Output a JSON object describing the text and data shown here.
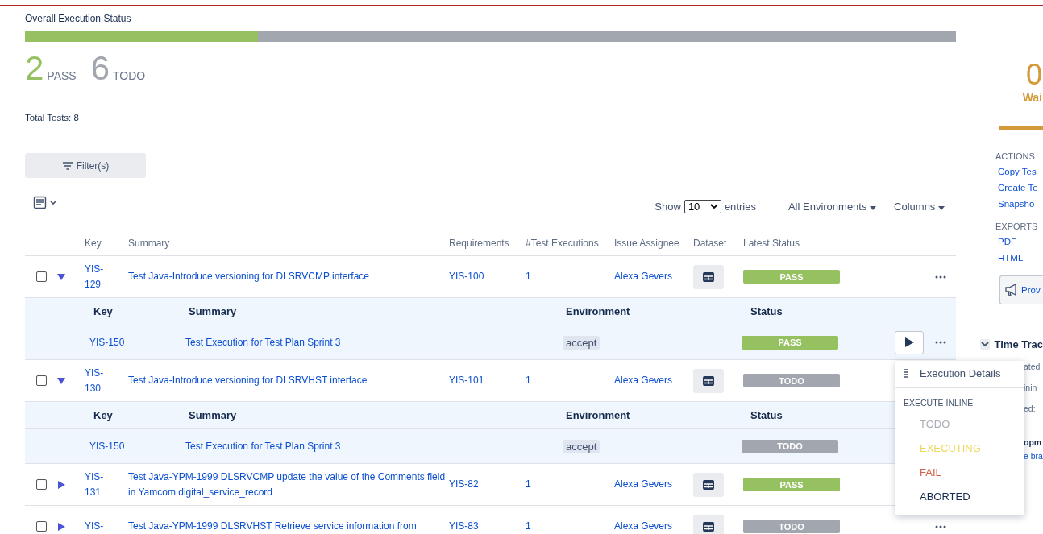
{
  "title": "Overall Execution Status",
  "progress": {
    "level": 0.25
  },
  "counts": [
    {
      "number": "2",
      "label": "PASS",
      "kind": "pass"
    },
    {
      "number": "6",
      "label": "TODO",
      "kind": "todo"
    }
  ],
  "total": "Total Tests: 8",
  "filter_button": "Filter(s)",
  "show": {
    "prefix": "Show",
    "value": "10",
    "suffix": "entries"
  },
  "environment_dropdown": "All Environments",
  "columns_dropdown": "Columns",
  "table": {
    "columns": [
      "Key",
      "Summary",
      "Requirements",
      "#Test Executions",
      "Issue Assignee",
      "Dataset",
      "Latest Status"
    ],
    "rows": [
      {
        "checked": false,
        "expanded": true,
        "key": "YIS-129",
        "summary": "Test Java-Introduce versioning for DLSRVCMP interface",
        "requirement": "YIS-100",
        "executions": "1",
        "assignee": "Alexa Gevers",
        "status": {
          "label": "PASS",
          "kind": "pass"
        },
        "sub": {
          "columns": [
            "Key",
            "Summary",
            "Environment",
            "Status"
          ],
          "rows": [
            {
              "key": "YIS-150",
              "summary": "Test Execution for Test Plan Sprint 3",
              "environment": "accept",
              "status": {
                "label": "PASS",
                "kind": "pass"
              },
              "run_button": true
            }
          ]
        }
      },
      {
        "checked": false,
        "expanded": true,
        "key": "YIS-130",
        "summary": "Test Java-Introduce versioning for DLSRVHST interface",
        "requirement": "YIS-101",
        "executions": "1",
        "assignee": "Alexa Gevers",
        "status": {
          "label": "TODO",
          "kind": "todo"
        },
        "sub": {
          "columns": [
            "Key",
            "Summary",
            "Environment",
            "Status"
          ],
          "rows": [
            {
              "key": "YIS-150",
              "summary": "Test Execution for Test Plan Sprint 3",
              "environment": "accept",
              "status": {
                "label": "TODO",
                "kind": "todo"
              },
              "run_button": false
            }
          ]
        }
      },
      {
        "checked": false,
        "expanded": false,
        "key": "YIS-131",
        "summary": "Test Java-YPM-1999 DLSRVCMP update the value of the Comments field in Yamcom digital_service_record",
        "requirement": "YIS-82",
        "executions": "1",
        "assignee": "Alexa Gevers",
        "status": {
          "label": "PASS",
          "kind": "pass"
        }
      },
      {
        "checked": false,
        "expanded": false,
        "key": "YIS-",
        "summary": "Test Java-YPM-1999 DLSRVHST Retrieve service information from",
        "requirement": "YIS-83",
        "executions": "1",
        "assignee": "Alexa Gevers",
        "status": {
          "label": "TODO",
          "kind": "todo"
        }
      }
    ]
  },
  "menu": {
    "details": "Execution Details",
    "section": "EXECUTE INLINE",
    "options": [
      {
        "label": "TODO",
        "color": "#a9adb5"
      },
      {
        "label": "EXECUTING",
        "color": "#ecd85e"
      },
      {
        "label": "FAIL",
        "color": "#d4604a"
      },
      {
        "label": "ABORTED",
        "color": "#172b4d"
      }
    ]
  },
  "sidebar": {
    "metric": {
      "number": "0",
      "label": "Wai"
    },
    "actions": {
      "title": "ACTIONS",
      "links": [
        "Copy Tes",
        "Create Te",
        "Snapsho"
      ]
    },
    "exports": {
      "title": "EXPORTS",
      "links": [
        "PDF",
        "HTML"
      ]
    },
    "button": "Prov",
    "time_tracking": {
      "title": "Time Trac",
      "fragments": [
        "ated",
        "inin",
        "ed:"
      ]
    },
    "development": {
      "title": "opm",
      "link": "e bra"
    }
  }
}
